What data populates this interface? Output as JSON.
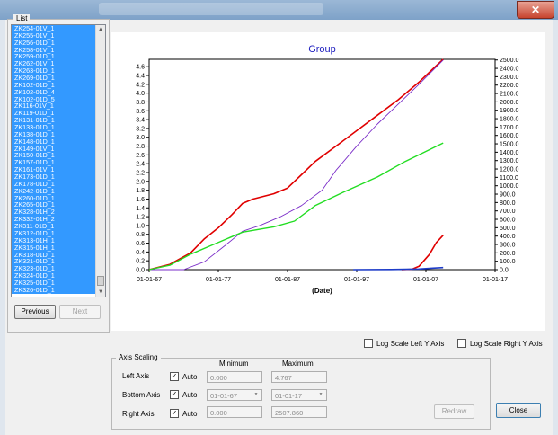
{
  "window": {
    "title_blurred": "",
    "close_label": "✕"
  },
  "list_group": {
    "label": "List",
    "items": [
      "ZK254-01V_1",
      "ZK255-01V_1",
      "ZK256-01D_1",
      "ZK258-01V_1",
      "ZK259-01D_1",
      "ZK262-01V_1",
      "ZK263-01D_1",
      "ZK269-01D_1",
      "ZK102-01D_1",
      "ZK102-01D_4",
      "ZK102-01D_5",
      "ZK116-01V_1",
      "ZK119-01D_1",
      "ZK131-01D_1",
      "ZK133-01D_1",
      "ZK138-01D_1",
      "ZK148-01D_1",
      "ZK149-01V_1",
      "ZK150-01D_1",
      "ZK157-01D_1",
      "ZK161-01V_1",
      "ZK173-01D_1",
      "ZK178-01D_1",
      "ZK242-01D_1",
      "ZK260-01D_1",
      "ZK265-01D_1",
      "ZK328-01H_2",
      "ZK332-01H_2",
      "ZK311-01D_1",
      "ZK312-01D_1",
      "ZK313-01H_1",
      "ZK315-01H_1",
      "ZK318-01D_1",
      "ZK321-01D_1",
      "ZK323-01D_1",
      "ZK324-01D_1",
      "ZK325-01D_1",
      "ZK326-01D_1"
    ],
    "previous_label": "Previous",
    "next_label": "Next"
  },
  "chart_data": {
    "type": "line",
    "title": "Group",
    "xlabel": "(Date)",
    "x_ticks": [
      "01-01-67",
      "01-01-77",
      "01-01-87",
      "01-01-97",
      "01-01-07",
      "01-01-17"
    ],
    "x_range": [
      "1967-01-01",
      "2017-01-01"
    ],
    "left_y": {
      "min": 0.0,
      "max": 4.767,
      "step": 0.2,
      "tick_labels": [
        "0.0",
        "0.2",
        "0.4",
        "0.6",
        "0.8",
        "1.0",
        "1.2",
        "1.4",
        "1.6",
        "1.8",
        "2.0",
        "2.2",
        "2.4",
        "2.6",
        "2.8",
        "3.0",
        "3.2",
        "3.4",
        "3.6",
        "3.8",
        "4.0",
        "4.2",
        "4.4",
        "4.6"
      ]
    },
    "right_y": {
      "min": 0.0,
      "max": 2507.86,
      "step": 100,
      "tick_labels": [
        "0.0",
        "100.0",
        "200.0",
        "300.0",
        "400.0",
        "500.0",
        "600.0",
        "700.0",
        "800.0",
        "900.0",
        "1000.0",
        "1100.0",
        "1200.0",
        "1300.0",
        "1400.0",
        "1500.0",
        "1600.0",
        "1700.0",
        "1800.0",
        "1900.0",
        "2000.0",
        "2100.0",
        "2200.0",
        "2300.0",
        "2400.0",
        "2500.0"
      ]
    },
    "series": [
      {
        "color": "#e00000",
        "axis": "left",
        "width": 1.6,
        "points": [
          [
            "1967-01-01",
            0
          ],
          [
            "1970-01-01",
            0.12
          ],
          [
            "1973-01-01",
            0.38
          ],
          [
            "1975-01-01",
            0.7
          ],
          [
            "1977-01-01",
            0.95
          ],
          [
            "1979-01-01",
            1.25
          ],
          [
            "1980-07-01",
            1.5
          ],
          [
            "1982-01-01",
            1.6
          ],
          [
            "1985-01-01",
            1.72
          ],
          [
            "1987-01-01",
            1.85
          ],
          [
            "1989-01-01",
            2.15
          ],
          [
            "1991-01-01",
            2.45
          ],
          [
            "1994-01-01",
            2.8
          ],
          [
            "1997-01-01",
            3.15
          ],
          [
            "2000-01-01",
            3.5
          ],
          [
            "2003-01-01",
            3.85
          ],
          [
            "2006-01-01",
            4.25
          ],
          [
            "2008-01-01",
            4.55
          ],
          [
            "2009-07-01",
            4.767
          ]
        ]
      },
      {
        "color": "#7a2cc8",
        "axis": "left",
        "width": 0.9,
        "points": [
          [
            "1967-01-01",
            0
          ],
          [
            "1972-01-01",
            0
          ],
          [
            "1975-01-01",
            0.18
          ],
          [
            "1978-01-01",
            0.55
          ],
          [
            "1980-07-01",
            0.87
          ],
          [
            "1983-01-01",
            1.0
          ],
          [
            "1986-01-01",
            1.2
          ],
          [
            "1989-01-01",
            1.45
          ],
          [
            "1992-01-01",
            1.8
          ],
          [
            "1994-01-01",
            2.25
          ],
          [
            "1997-01-01",
            2.8
          ],
          [
            "2000-01-01",
            3.3
          ],
          [
            "2003-01-01",
            3.75
          ],
          [
            "2006-01-01",
            4.2
          ],
          [
            "2009-07-01",
            4.75
          ]
        ]
      },
      {
        "color": "#22dd22",
        "axis": "left",
        "width": 1.4,
        "points": [
          [
            "1967-01-01",
            0
          ],
          [
            "1970-01-01",
            0.1
          ],
          [
            "1973-01-01",
            0.35
          ],
          [
            "1976-01-01",
            0.55
          ],
          [
            "1980-07-01",
            0.85
          ],
          [
            "1985-01-01",
            0.97
          ],
          [
            "1988-01-01",
            1.1
          ],
          [
            "1991-01-01",
            1.45
          ],
          [
            "1995-01-01",
            1.75
          ],
          [
            "2000-01-01",
            2.1
          ],
          [
            "2004-01-01",
            2.45
          ],
          [
            "2009-07-01",
            2.87
          ]
        ]
      },
      {
        "color": "#e00000",
        "axis": "right",
        "width": 1.6,
        "points": [
          [
            "2003-07-01",
            0
          ],
          [
            "2005-01-01",
            5
          ],
          [
            "2006-01-01",
            40
          ],
          [
            "2007-07-01",
            180
          ],
          [
            "2008-07-01",
            320
          ],
          [
            "2009-07-01",
            410
          ]
        ]
      },
      {
        "color": "#1e3cc8",
        "axis": "right",
        "width": 1.6,
        "points": [
          [
            "1996-07-01",
            0
          ],
          [
            "2002-01-01",
            2
          ],
          [
            "2006-01-01",
            8
          ],
          [
            "2008-01-01",
            18
          ],
          [
            "2009-07-01",
            25
          ]
        ]
      }
    ]
  },
  "log_left_label": "Log Scale Left Y Axis",
  "log_right_label": "Log Scale Right Y Axis",
  "axis_scaling": {
    "label": "Axis Scaling",
    "minimum_header": "Minimum",
    "maximum_header": "Maximum",
    "rows": [
      {
        "label": "Left Axis",
        "auto_label": "Auto",
        "checked": true,
        "min": "0.000",
        "max": "4.767",
        "dropdown": false
      },
      {
        "label": "Bottom Axis",
        "auto_label": "Auto",
        "checked": true,
        "min": "01-01-67",
        "max": "01-01-17",
        "dropdown": true
      },
      {
        "label": "Right Axis",
        "auto_label": "Auto",
        "checked": true,
        "min": "0.000",
        "max": "2507.860",
        "dropdown": false
      }
    ],
    "redraw_label": "Redraw"
  },
  "close_label": "Close",
  "icons": {
    "check": "✓",
    "dropdown": "▾",
    "scroll_up": "▲",
    "scroll_down": "▼"
  }
}
